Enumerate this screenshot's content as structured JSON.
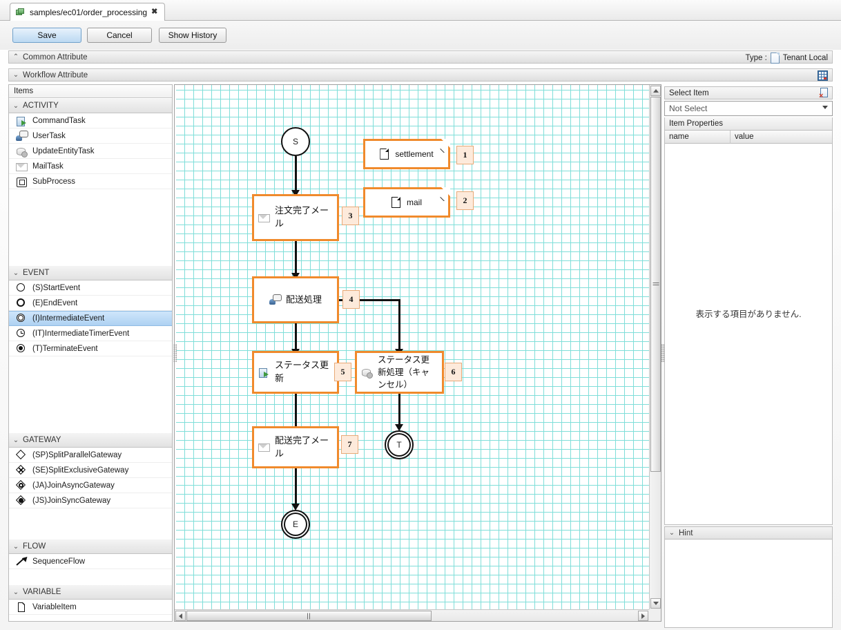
{
  "tab": {
    "title": "samples/ec01/order_processing",
    "close_label": "✖"
  },
  "toolbar": {
    "save_label": "Save",
    "cancel_label": "Cancel",
    "history_label": "Show History"
  },
  "attributes": {
    "common_label": "Common Attribute",
    "common_chevron": "⌃",
    "workflow_label": "Workflow Attribute",
    "workflow_chevron": "⌄",
    "type_label": "Type :",
    "type_value": "Tenant Local"
  },
  "palette": {
    "header": "Items",
    "groups": [
      {
        "name": "ACTIVITY",
        "chevron": "⌄",
        "items": [
          {
            "label": "CommandTask",
            "icon": "command-task-icon",
            "selected": false
          },
          {
            "label": "UserTask",
            "icon": "user-task-icon",
            "selected": false
          },
          {
            "label": "UpdateEntityTask",
            "icon": "update-entity-task-icon",
            "selected": false
          },
          {
            "label": "MailTask",
            "icon": "mail-task-icon",
            "selected": false
          },
          {
            "label": "SubProcess",
            "icon": "sub-process-icon",
            "selected": false
          }
        ]
      },
      {
        "name": "EVENT",
        "chevron": "⌄",
        "items": [
          {
            "label": "(S)StartEvent",
            "icon": "start-event-icon",
            "selected": false
          },
          {
            "label": "(E)EndEvent",
            "icon": "end-event-icon",
            "selected": false
          },
          {
            "label": "(I)IntermediateEvent",
            "icon": "intermediate-event-icon",
            "selected": true
          },
          {
            "label": "(IT)IntermediateTimerEvent",
            "icon": "intermediate-timer-event-icon",
            "selected": false
          },
          {
            "label": "(T)TerminateEvent",
            "icon": "terminate-event-icon",
            "selected": false
          }
        ]
      },
      {
        "name": "GATEWAY",
        "chevron": "⌄",
        "items": [
          {
            "label": "(SP)SplitParallelGateway",
            "icon": "split-parallel-gateway-icon",
            "selected": false
          },
          {
            "label": "(SE)SplitExclusiveGateway",
            "icon": "split-exclusive-gateway-icon",
            "selected": false
          },
          {
            "label": "(JA)JoinAsyncGateway",
            "icon": "join-async-gateway-icon",
            "selected": false
          },
          {
            "label": "(JS)JoinSyncGateway",
            "icon": "join-sync-gateway-icon",
            "selected": false
          }
        ]
      },
      {
        "name": "FLOW",
        "chevron": "⌄",
        "items": [
          {
            "label": "SequenceFlow",
            "icon": "sequence-flow-icon",
            "selected": false
          }
        ]
      },
      {
        "name": "VARIABLE",
        "chevron": "⌄",
        "items": [
          {
            "label": "VariableItem",
            "icon": "variable-item-icon",
            "selected": false
          }
        ]
      }
    ]
  },
  "canvas": {
    "nodes": {
      "start_event": {
        "label": "S",
        "type": "start-event"
      },
      "task_order_mail": {
        "label": "注文完了メール",
        "icon": "mail-task-icon",
        "badge": "3"
      },
      "task_delivery": {
        "label": "配送処理",
        "icon": "user-task-icon",
        "badge": "4"
      },
      "task_status_update": {
        "label": "ステータス更新",
        "icon": "command-task-icon",
        "badge": "5"
      },
      "task_status_cancel": {
        "label": "ステータス更新処理（キャンセル）",
        "icon": "update-entity-task-icon",
        "badge": "6"
      },
      "task_delivery_mail": {
        "label": "配送完了メール",
        "icon": "mail-task-icon",
        "badge": "7"
      },
      "var_settlement": {
        "label": "settlement",
        "icon": "variable-item-icon",
        "badge": "1"
      },
      "var_mail": {
        "label": "mail",
        "icon": "variable-item-icon",
        "badge": "2"
      },
      "terminate_event": {
        "label": "T",
        "type": "terminate-event"
      },
      "end_event": {
        "label": "E",
        "type": "end-event"
      }
    },
    "hscroll_grip": "∣∣∣"
  },
  "right_panel": {
    "select_item_label": "Select Item",
    "select_value": "Not Select",
    "select_options": [
      "Not Select"
    ],
    "item_properties_label": "Item Properties",
    "col_name": "name",
    "col_value": "value",
    "empty_text": "表示する項目がありません.",
    "hint_label": "Hint",
    "hint_chevron": "⌄"
  },
  "colors": {
    "accent_orange": "#f08a2c",
    "badge_bg": "#fdeadb",
    "grid_line": "#7fded9",
    "selection_blue": "#aed1f2"
  }
}
